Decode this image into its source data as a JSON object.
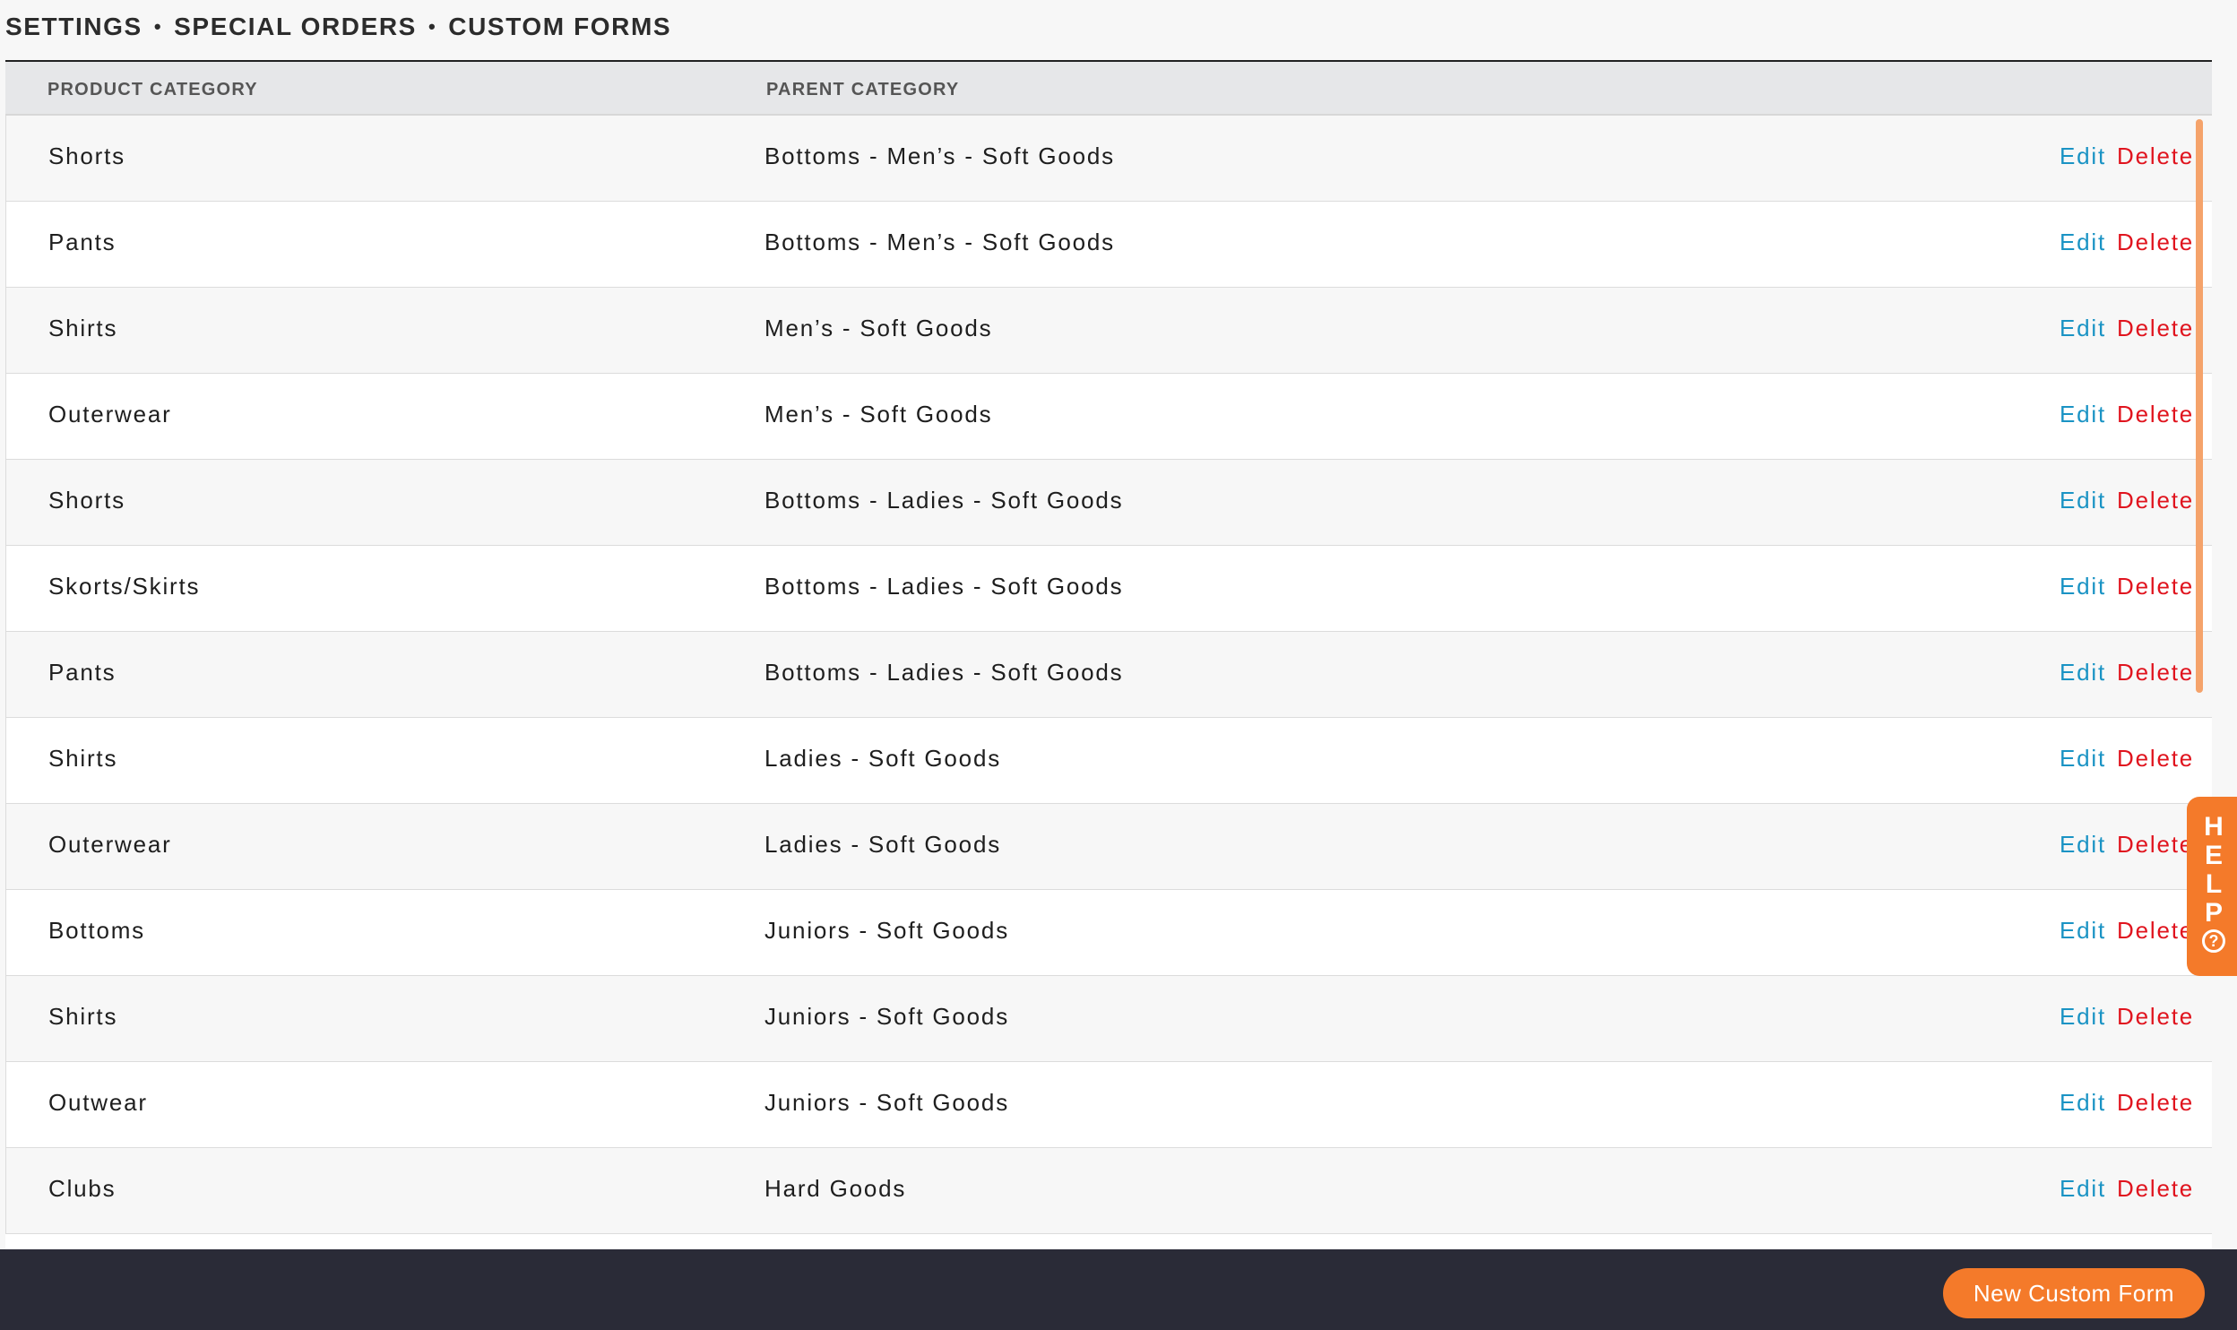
{
  "breadcrumb": {
    "part1": "SETTINGS",
    "part2": "SPECIAL ORDERS",
    "part3": "CUSTOM FORMS",
    "separator": "•"
  },
  "table": {
    "headers": {
      "product_category": "PRODUCT CATEGORY",
      "parent_category": "PARENT CATEGORY"
    },
    "edit_label": "Edit",
    "delete_label": "Delete",
    "rows": [
      {
        "category": "Shorts",
        "parent": "Bottoms - Men’s - Soft Goods"
      },
      {
        "category": "Pants",
        "parent": "Bottoms - Men’s - Soft Goods"
      },
      {
        "category": "Shirts",
        "parent": "Men’s - Soft Goods"
      },
      {
        "category": "Outerwear",
        "parent": "Men’s - Soft Goods"
      },
      {
        "category": "Shorts",
        "parent": "Bottoms - Ladies - Soft Goods"
      },
      {
        "category": "Skorts/Skirts",
        "parent": "Bottoms - Ladies - Soft Goods"
      },
      {
        "category": "Pants",
        "parent": "Bottoms - Ladies - Soft Goods"
      },
      {
        "category": "Shirts",
        "parent": "Ladies - Soft Goods"
      },
      {
        "category": "Outerwear",
        "parent": "Ladies - Soft Goods"
      },
      {
        "category": "Bottoms",
        "parent": "Juniors - Soft Goods"
      },
      {
        "category": "Shirts",
        "parent": "Juniors - Soft Goods"
      },
      {
        "category": "Outwear",
        "parent": "Juniors - Soft Goods"
      },
      {
        "category": "Clubs",
        "parent": "Hard Goods"
      }
    ]
  },
  "help_tab": {
    "letters": [
      "H",
      "E",
      "L",
      "P"
    ],
    "icon": "question-circle-icon"
  },
  "footer": {
    "new_button_label": "New Custom Form"
  },
  "colors": {
    "accent": "#f47a2a",
    "edit": "#1a93c4",
    "delete": "#e0141e",
    "footer_bg": "#2a2b37"
  }
}
